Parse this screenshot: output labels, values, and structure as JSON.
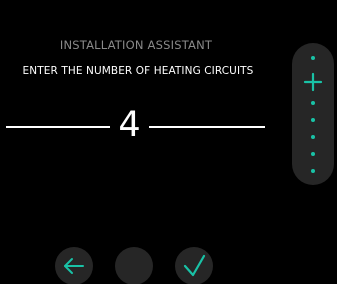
{
  "header": {
    "title": "INSTALLATION ASSISTANT",
    "prompt": "ENTER THE NUMBER OF HEATING CIRCUITS"
  },
  "value_input": {
    "value": "4"
  },
  "side_control": {
    "increment_icon": "plus-icon",
    "dots_icon": "dot-icon"
  },
  "footer_nav": {
    "back_icon": "arrow-left-icon",
    "confirm_icon": "checkmark-icon"
  },
  "colors": {
    "background": "#000000",
    "accent": "#19c2a6",
    "button_fill": "#262626",
    "title_text": "#8a8a8a",
    "primary_text": "#ffffff"
  }
}
